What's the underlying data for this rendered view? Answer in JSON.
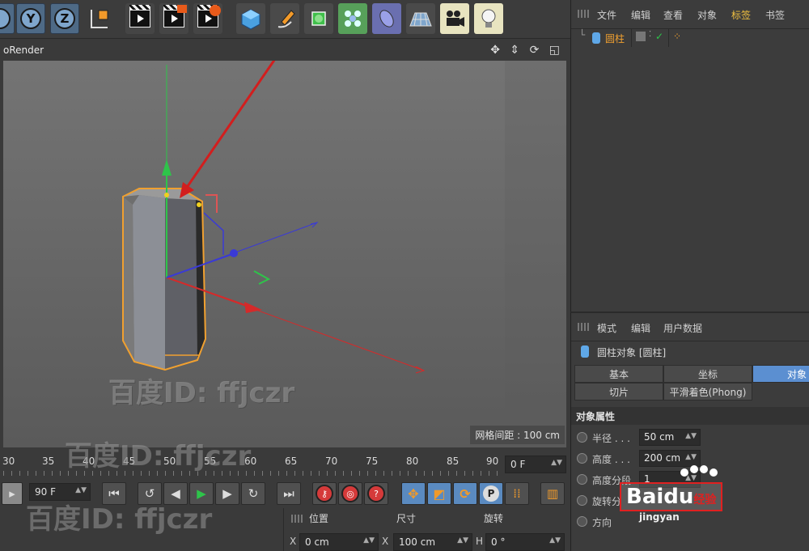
{
  "toolbar": {
    "axis_buttons": [
      "Y",
      "Z"
    ],
    "items": [
      "coord-system",
      "render-view",
      "render-picture",
      "render-settings",
      "cube",
      "pen",
      "subdivision",
      "cloner",
      "deformer",
      "floor",
      "camera",
      "light"
    ]
  },
  "viewport": {
    "title": "oRender",
    "nav_icons": "✥ ⇕ ⟳ ◱",
    "grid_spacing": "网格间距 : 100 cm"
  },
  "timeline": {
    "ticks": [
      "30",
      "35",
      "40",
      "45",
      "50",
      "55",
      "60",
      "65",
      "70",
      "75",
      "80",
      "85",
      "90"
    ],
    "current_frame": "0 F",
    "end_frame": "90 F"
  },
  "coords": {
    "headers": {
      "position": "位置",
      "size": "尺寸",
      "rotation": "旋转"
    },
    "x_label": "X",
    "x_position": "0 cm",
    "x_size_label": "X",
    "x_size": "100 cm",
    "h_label": "H",
    "h_rotation": "0 °"
  },
  "object_manager": {
    "menu": [
      "文件",
      "编辑",
      "查看",
      "对象",
      "标签",
      "书签"
    ],
    "objects": [
      {
        "name": "圆柱"
      }
    ]
  },
  "attribute_manager": {
    "menu": [
      "模式",
      "编辑",
      "用户数据"
    ],
    "object_title": "圆柱对象 [圆柱]",
    "tabs_row1": [
      "基本",
      "坐标",
      "对象"
    ],
    "tabs_row2": [
      "切片",
      "平滑着色(Phong)"
    ],
    "section": "对象属性",
    "props": [
      {
        "label": "半径 . . .",
        "value": "50 cm"
      },
      {
        "label": "高度 . . .",
        "value": "200 cm"
      },
      {
        "label": "高度分段",
        "value": "1"
      },
      {
        "label": "旋转分",
        "value": ""
      },
      {
        "label": "方向",
        "value": ""
      }
    ]
  },
  "watermarks": {
    "text": "百度ID: ffjczr",
    "baidu": "Baidu",
    "baidu_suffix": "经验",
    "baidu_sub": "jingyan"
  },
  "colors": {
    "accent": "#5b8fd1",
    "selection": "#f0a030",
    "axis_y": "#2ec44a",
    "axis_x": "#d52a2a",
    "axis_z": "#3a3ad6",
    "annotation_arrow": "#d21e1e"
  }
}
